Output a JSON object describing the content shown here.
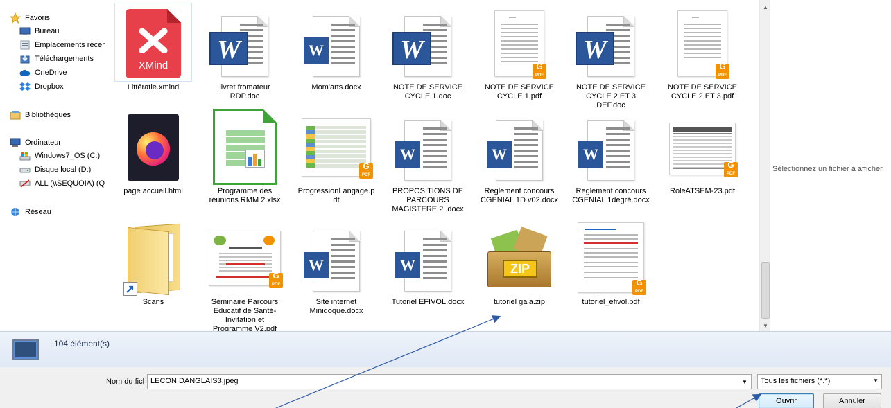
{
  "nav": {
    "favorites": "Favoris",
    "bureau": "Bureau",
    "recent": "Emplacements récen",
    "downloads": "Téléchargements",
    "onedrive": "OneDrive",
    "dropbox": "Dropbox",
    "libraries": "Bibliothèques",
    "computer": "Ordinateur",
    "drive_c": "Windows7_OS (C:)",
    "drive_d": "Disque local (D:)",
    "drive_q": "ALL (\\\\SEQUOIA) (Q",
    "network": "Réseau"
  },
  "files": [
    {
      "name": "Littératie.xmind",
      "icon": "xmind-icon"
    },
    {
      "name": "livret fromateur RDP.doc",
      "icon": "word-doc-icon"
    },
    {
      "name": "Mom'arts.docx",
      "icon": "word-docx-icon"
    },
    {
      "name": "NOTE DE SERVICE CYCLE 1.doc",
      "icon": "word-doc-icon"
    },
    {
      "name": "NOTE DE SERVICE CYCLE 1.pdf",
      "icon": "pdf-thumbnail"
    },
    {
      "name": "NOTE DE SERVICE CYCLE 2 ET 3 DEF.doc",
      "icon": "word-doc-icon"
    },
    {
      "name": "NOTE DE SERVICE CYCLE 2 ET 3.pdf",
      "icon": "pdf-thumbnail"
    },
    {
      "name": "page accueil.html",
      "icon": "firefox-icon"
    },
    {
      "name": "Programme des réunions RMM 2.xlsx",
      "icon": "spreadsheet-icon"
    },
    {
      "name": "ProgressionLangage.pdf",
      "icon": "pdf-thumbnail"
    },
    {
      "name": "PROPOSITIONS DE PARCOURS MAGISTERE 2 .docx",
      "icon": "word-docx-icon"
    },
    {
      "name": "Reglement concours CGENIAL 1D v02.docx",
      "icon": "word-docx-icon"
    },
    {
      "name": "Reglement concours CGENIAL 1degré.docx",
      "icon": "word-docx-icon"
    },
    {
      "name": "RoleATSEM-23.pdf",
      "icon": "pdf-thumbnail"
    },
    {
      "name": "Scans",
      "icon": "folder-shortcut-icon"
    },
    {
      "name": "Séminaire Parcours Educatif de Santé-Invitation et Programme V2.pdf",
      "icon": "pdf-thumbnail"
    },
    {
      "name": "Site internet Minidoque.docx",
      "icon": "word-docx-icon"
    },
    {
      "name": "Tutoriel EFIVOL.docx",
      "icon": "word-docx-icon"
    },
    {
      "name": "tutoriel gaia.zip",
      "icon": "zip-icon"
    },
    {
      "name": "tutoriel_efivol.pdf",
      "icon": "pdf-thumbnail"
    }
  ],
  "preview": {
    "hint": "Sélectionnez un fichier à afficher"
  },
  "details": {
    "count": "104 élément(s)"
  },
  "bottom": {
    "filename_label": "Nom du fichier :",
    "filename_value": "LECON DANGLAIS3.jpeg",
    "filetype": "Tous les fichiers (*.*)",
    "open_label": "Ouvrir",
    "cancel_label": "Annuler"
  },
  "colors": {
    "word": "#2b579a",
    "pdf_badge": "#f39200",
    "xmind": "#e8404b",
    "accent": "#3c7fb1"
  }
}
